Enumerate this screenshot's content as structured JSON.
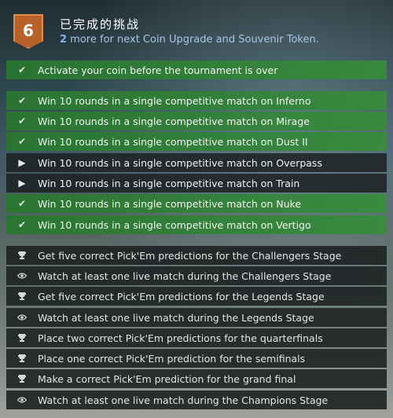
{
  "header": {
    "level": "6",
    "title": "已完成的挑战",
    "subtitle_count": "2",
    "subtitle_rest": " more for next Coin Upgrade and Souvenir Token."
  },
  "activation": {
    "label": "Activate your coin before the tournament is over",
    "status": "complete"
  },
  "map_challenges": [
    {
      "label": "Win 10 rounds in a single competitive match on Inferno",
      "status": "complete"
    },
    {
      "label": "Win 10 rounds in a single competitive match on Mirage",
      "status": "complete"
    },
    {
      "label": "Win 10 rounds in a single competitive match on Dust II",
      "status": "complete"
    },
    {
      "label": "Win 10 rounds in a single competitive match on Overpass",
      "status": "play"
    },
    {
      "label": "Win 10 rounds in a single competitive match on Train",
      "status": "play"
    },
    {
      "label": "Win 10 rounds in a single competitive match on Nuke",
      "status": "complete"
    },
    {
      "label": "Win 10 rounds in a single competitive match on Vertigo",
      "status": "complete"
    }
  ],
  "tournament_challenges": [
    {
      "label": "Get five correct Pick'Em predictions for the Challengers Stage",
      "icon": "trophy-icon"
    },
    {
      "label": "Watch at least one live match during the Challengers Stage",
      "icon": "eye-icon"
    },
    {
      "label": "Get five correct Pick'Em predictions for the Legends Stage",
      "icon": "trophy-icon"
    },
    {
      "label": "Watch at least one live match during the Legends Stage",
      "icon": "eye-icon"
    },
    {
      "label": "Place two correct Pick'Em predictions for the quarterfinals",
      "icon": "trophy-icon"
    },
    {
      "label": "Place one correct Pick'Em prediction for the semifinals",
      "icon": "trophy-icon"
    },
    {
      "label": "Make a correct Pick'Em prediction for the grand final",
      "icon": "trophy-icon"
    },
    {
      "label": "Watch at least one live match during the Champions Stage",
      "icon": "eye-icon"
    }
  ],
  "colors": {
    "complete": "#2e8a36",
    "incomplete": "#1c2224",
    "badge": "#b8622a",
    "subtitle": "#a8c4e8"
  }
}
